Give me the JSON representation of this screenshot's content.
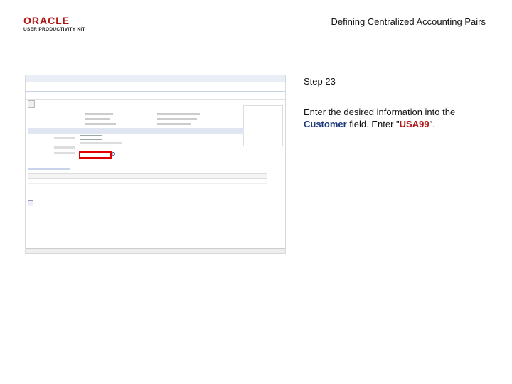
{
  "header": {
    "logo_text": "ORACLE",
    "logo_sub": "USER PRODUCTIVITY KIT",
    "doc_title": "Defining Centralized Accounting Pairs"
  },
  "step": {
    "number": "Step 23",
    "instr_prefix": "Enter the desired information into the ",
    "field": "Customer",
    "instr_mid": " field. Enter \"",
    "value": "USA99",
    "instr_suffix": "\"."
  },
  "screenshot": {
    "highlight_color": "#e00000"
  }
}
